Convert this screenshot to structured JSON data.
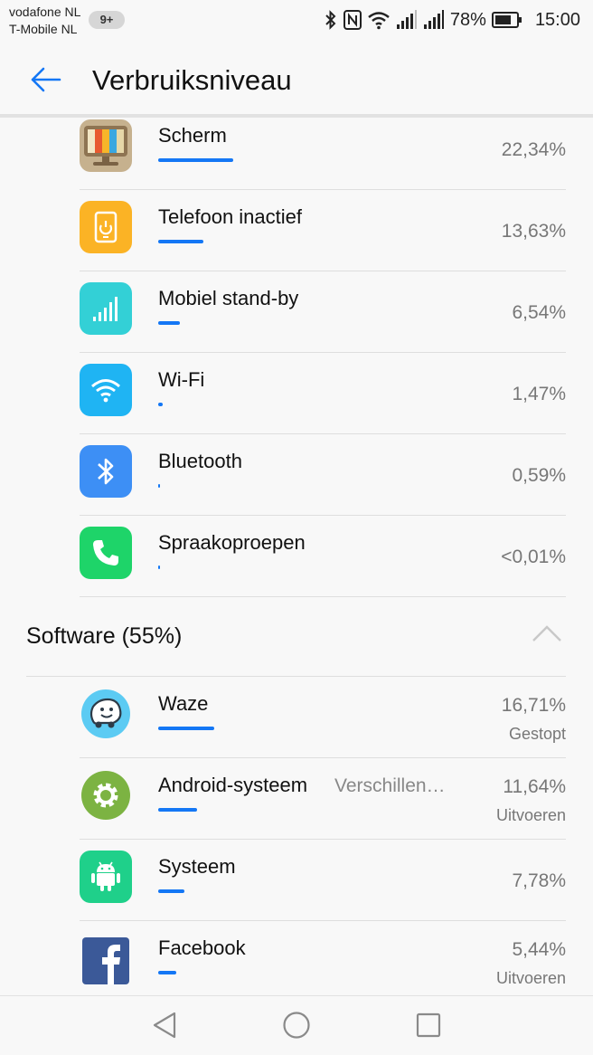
{
  "status_bar": {
    "carrier_1": "vodafone NL",
    "carrier_2": "T-Mobile  NL",
    "notification_count": "9+",
    "battery": "78%",
    "time": "15:00"
  },
  "header": {
    "title": "Verbruiksniveau"
  },
  "hardware_items": [
    {
      "name": "Scherm",
      "value": "22,34%",
      "share": 22.34,
      "icon": "screen-icon",
      "color": "#a58b62"
    },
    {
      "name": "Telefoon inactief",
      "value": "13,63%",
      "share": 13.63,
      "icon": "phone-idle-icon",
      "color": "#fbb325"
    },
    {
      "name": "Mobiel stand-by",
      "value": "6,54%",
      "share": 6.54,
      "icon": "signal-icon",
      "color": "#33d0d6"
    },
    {
      "name": "Wi-Fi",
      "value": "1,47%",
      "share": 1.47,
      "icon": "wifi-icon",
      "color": "#1fb4f3"
    },
    {
      "name": "Bluetooth",
      "value": "0,59%",
      "share": 0.59,
      "icon": "bluetooth-icon",
      "color": "#3d8ff5"
    },
    {
      "name": "Spraakoproepen",
      "value": "<0,01%",
      "share": 0.01,
      "icon": "call-icon",
      "color": "#1ed469"
    }
  ],
  "software_section": {
    "title": "Software (55%)"
  },
  "software_items": [
    {
      "name": "Waze",
      "value": "16,71%",
      "share": 16.71,
      "status": "Gestopt",
      "icon": "waze-icon",
      "color": "#5ccbf3"
    },
    {
      "name": "Android-systeem",
      "extra": "Verschillen…",
      "value": "11,64%",
      "share": 11.64,
      "status": "Uitvoeren",
      "icon": "settings-gear-icon",
      "color": "#7cb342"
    },
    {
      "name": "Systeem",
      "value": "7,78%",
      "share": 7.78,
      "icon": "android-icon",
      "color": "#1fd08a"
    },
    {
      "name": "Facebook",
      "value": "5,44%",
      "share": 5.44,
      "status": "Uitvoeren",
      "icon": "facebook-icon",
      "color": "#3b5998"
    }
  ],
  "nav": {
    "back": "back-triangle-icon",
    "home": "home-circle-icon",
    "recents": "recents-square-icon"
  }
}
